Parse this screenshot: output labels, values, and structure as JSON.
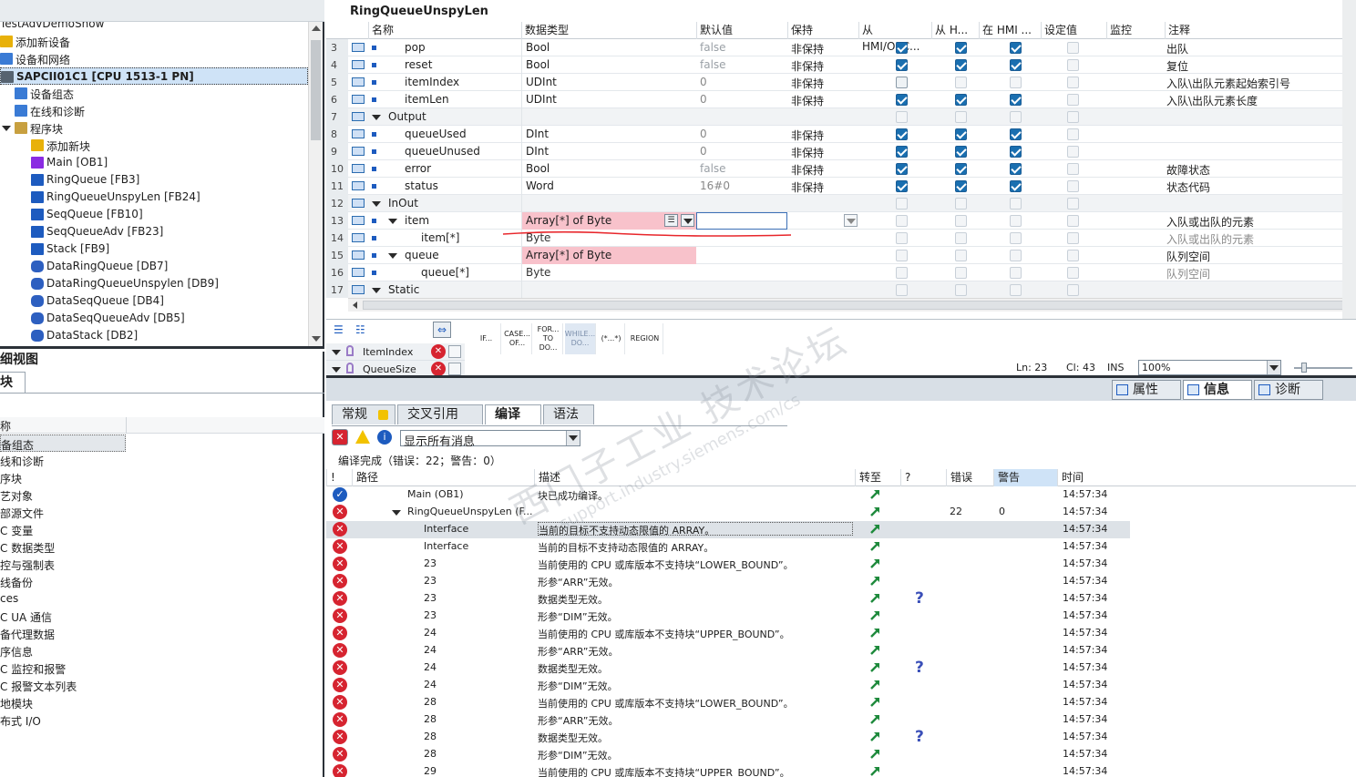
{
  "tree": {
    "items": [
      {
        "label": "TestAdvDemoShow",
        "icon": "project-icon",
        "indent": 0
      },
      {
        "label": "添加新设备",
        "icon": "add-device-icon",
        "indent": 1
      },
      {
        "label": "设备和网络",
        "icon": "network-icon",
        "indent": 1
      },
      {
        "label": "SAPCII01C1 [CPU 1513-1 PN]",
        "icon": "cpu-icon",
        "indent": 1,
        "selected": true
      },
      {
        "label": "设备组态",
        "icon": "device-config-icon",
        "indent": 2
      },
      {
        "label": "在线和诊断",
        "icon": "online-diag-icon",
        "indent": 2
      },
      {
        "label": "程序块",
        "icon": "folder-icon",
        "indent": 2
      },
      {
        "label": "添加新块",
        "icon": "add-block-icon",
        "indent": 3
      },
      {
        "label": "Main [OB1]",
        "icon": "ob-icon",
        "indent": 3
      },
      {
        "label": "RingQueue [FB3]",
        "icon": "fb-icon",
        "indent": 3
      },
      {
        "label": "RingQueueUnspyLen [FB24]",
        "icon": "fb-icon",
        "indent": 3
      },
      {
        "label": "SeqQueue [FB10]",
        "icon": "fb-icon",
        "indent": 3
      },
      {
        "label": "SeqQueueAdv [FB23]",
        "icon": "fb-icon",
        "indent": 3
      },
      {
        "label": "Stack [FB9]",
        "icon": "fb-icon",
        "indent": 3
      },
      {
        "label": "DataRingQueue [DB7]",
        "icon": "db-icon",
        "indent": 3
      },
      {
        "label": "DataRingQueueUnspylen [DB9]",
        "icon": "db-icon",
        "indent": 3
      },
      {
        "label": "DataSeqQueue [DB4]",
        "icon": "db-icon",
        "indent": 3
      },
      {
        "label": "DataSeqQueueAdv [DB5]",
        "icon": "db-icon",
        "indent": 3
      },
      {
        "label": "DataStack [DB2]",
        "icon": "db-icon",
        "indent": 3
      }
    ]
  },
  "detail": {
    "title": "细视图",
    "tab": "块",
    "col_header": "称",
    "items": [
      "备组态",
      "线和诊断",
      "序块",
      "艺对象",
      "部源文件",
      "C 变量",
      "C 数据类型",
      "控与强制表",
      "线备份",
      "ces",
      "C UA 通信",
      "备代理数据",
      "序信息",
      "C 监控和报警",
      "C 报警文本列表",
      "地模块",
      "布式 I/O"
    ]
  },
  "block": {
    "title": "RingQueueUnspyLen",
    "headers": [
      "名称",
      "数据类型",
      "默认值",
      "保持",
      "从 HMI/OPC...",
      "从 H...",
      "在 HMI ...",
      "设定值",
      "监控",
      "注释"
    ],
    "rows": [
      {
        "num": "3",
        "name": "pop",
        "type": "Bool",
        "def": "false",
        "ret": "非保持",
        "c1": "on",
        "c2": "on",
        "c3": "on",
        "note": "出队",
        "lvl": 1
      },
      {
        "num": "4",
        "name": "reset",
        "type": "Bool",
        "def": "false",
        "ret": "非保持",
        "c1": "on",
        "c2": "on",
        "c3": "on",
        "note": "复位",
        "lvl": 1
      },
      {
        "num": "5",
        "name": "itemIndex",
        "type": "UDInt",
        "def": "0",
        "ret": "非保持",
        "c1": "off",
        "c2": "dis",
        "c3": "dis",
        "note": "入队\\出队元素起始索引号",
        "lvl": 1
      },
      {
        "num": "6",
        "name": "itemLen",
        "type": "UDInt",
        "def": "0",
        "ret": "非保持",
        "c1": "on",
        "c2": "on",
        "c3": "on",
        "note": "入队\\出队元素长度",
        "lvl": 1
      },
      {
        "num": "7",
        "name": "Output",
        "type": "",
        "def": "",
        "ret": "",
        "c1": "dis",
        "c2": "dis",
        "c3": "dis",
        "note": "",
        "lvl": 0,
        "group": true
      },
      {
        "num": "8",
        "name": "queueUsed",
        "type": "DInt",
        "def": "0",
        "ret": "非保持",
        "c1": "on",
        "c2": "on",
        "c3": "on",
        "note": "",
        "lvl": 1
      },
      {
        "num": "9",
        "name": "queueUnused",
        "type": "DInt",
        "def": "0",
        "ret": "非保持",
        "c1": "on",
        "c2": "on",
        "c3": "on",
        "note": "",
        "lvl": 1
      },
      {
        "num": "10",
        "name": "error",
        "type": "Bool",
        "def": "false",
        "ret": "非保持",
        "c1": "on",
        "c2": "on",
        "c3": "on",
        "note": "故障状态",
        "lvl": 1
      },
      {
        "num": "11",
        "name": "status",
        "type": "Word",
        "def": "16#0",
        "ret": "非保持",
        "c1": "on",
        "c2": "on",
        "c3": "on",
        "note": "状态代码",
        "lvl": 1
      },
      {
        "num": "12",
        "name": "InOut",
        "type": "",
        "def": "",
        "ret": "",
        "c1": "dis",
        "c2": "dis",
        "c3": "dis",
        "note": "",
        "lvl": 0,
        "group": true
      },
      {
        "num": "13",
        "name": "item",
        "type": "Array[*] of Byte",
        "def": "",
        "ret": "",
        "c1": "dis",
        "c2": "dis",
        "c3": "dis",
        "note": "入队或出队的元素",
        "lvl": 1,
        "expand": true,
        "pink": true,
        "editing": true
      },
      {
        "num": "14",
        "name": "item[*]",
        "type": "Byte",
        "def": "",
        "ret": "",
        "c1": "dis",
        "c2": "dis",
        "c3": "dis",
        "note": "入队或出队的元素",
        "lvl": 2,
        "grey": true
      },
      {
        "num": "15",
        "name": "queue",
        "type": "Array[*] of Byte",
        "def": "",
        "ret": "",
        "c1": "dis",
        "c2": "dis",
        "c3": "dis",
        "note": "队列空间",
        "lvl": 1,
        "expand": true,
        "pink": true
      },
      {
        "num": "16",
        "name": "queue[*]",
        "type": "Byte",
        "def": "",
        "ret": "",
        "c1": "dis",
        "c2": "dis",
        "c3": "dis",
        "note": "队列空间",
        "lvl": 2,
        "grey": true
      },
      {
        "num": "17",
        "name": "Static",
        "type": "",
        "def": "",
        "ret": "",
        "c1": "dis",
        "c2": "dis",
        "c3": "dis",
        "note": "",
        "lvl": 0,
        "group": true
      }
    ]
  },
  "editor": {
    "vars": [
      "ItemIndex",
      "QueueSize"
    ],
    "instructions": [
      "IF...",
      "CASE... OF...",
      "FOR... TO DO...",
      "WHILE... DO...",
      "(*...*)",
      "REGION"
    ],
    "ln": "Ln: 23",
    "cl": "Cl: 43",
    "ins": "INS",
    "zoom": "100%"
  },
  "inspector": {
    "tabs": [
      "属性",
      "信息",
      "诊断"
    ]
  },
  "info": {
    "tabs": [
      "常规",
      "交叉引用",
      "编译",
      "语法"
    ],
    "filter": "显示所有消息",
    "summary": "编译完成（错误：22；警告：0）",
    "headers": [
      "!",
      "路径",
      "描述",
      "转至",
      "?",
      "错误",
      "警告",
      "时间"
    ],
    "rows": [
      {
        "type": "ok",
        "path": "Main (OB1)",
        "desc": "块已成功编译。",
        "q": false,
        "err": "",
        "warn": "",
        "time": "14:57:34",
        "lvl": 0
      },
      {
        "type": "err",
        "path": "RingQueueUnspyLen (F...",
        "desc": "",
        "q": false,
        "err": "22",
        "warn": "0",
        "time": "14:57:34",
        "lvl": 0,
        "expand": true
      },
      {
        "type": "err",
        "path": "Interface",
        "desc": "当前的目标不支持动态限值的 ARRAY。",
        "q": false,
        "err": "",
        "warn": "",
        "time": "14:57:34",
        "lvl": 1,
        "sel": true
      },
      {
        "type": "err",
        "path": "Interface",
        "desc": "当前的目标不支持动态限值的 ARRAY。",
        "q": false,
        "err": "",
        "warn": "",
        "time": "14:57:34",
        "lvl": 1
      },
      {
        "type": "err",
        "path": "23",
        "desc": "当前使用的 CPU 或库版本不支持块“LOWER_BOUND”。",
        "q": false,
        "err": "",
        "warn": "",
        "time": "14:57:34",
        "lvl": 1
      },
      {
        "type": "err",
        "path": "23",
        "desc": "形参“ARR”无效。",
        "q": false,
        "err": "",
        "warn": "",
        "time": "14:57:34",
        "lvl": 1
      },
      {
        "type": "err",
        "path": "23",
        "desc": "数据类型无效。",
        "q": true,
        "err": "",
        "warn": "",
        "time": "14:57:34",
        "lvl": 1
      },
      {
        "type": "err",
        "path": "23",
        "desc": "形参“DIM”无效。",
        "q": false,
        "err": "",
        "warn": "",
        "time": "14:57:34",
        "lvl": 1
      },
      {
        "type": "err",
        "path": "24",
        "desc": "当前使用的 CPU 或库版本不支持块“UPPER_BOUND”。",
        "q": false,
        "err": "",
        "warn": "",
        "time": "14:57:34",
        "lvl": 1
      },
      {
        "type": "err",
        "path": "24",
        "desc": "形参“ARR”无效。",
        "q": false,
        "err": "",
        "warn": "",
        "time": "14:57:34",
        "lvl": 1
      },
      {
        "type": "err",
        "path": "24",
        "desc": "数据类型无效。",
        "q": true,
        "err": "",
        "warn": "",
        "time": "14:57:34",
        "lvl": 1
      },
      {
        "type": "err",
        "path": "24",
        "desc": "形参“DIM”无效。",
        "q": false,
        "err": "",
        "warn": "",
        "time": "14:57:34",
        "lvl": 1
      },
      {
        "type": "err",
        "path": "28",
        "desc": "当前使用的 CPU 或库版本不支持块“LOWER_BOUND”。",
        "q": false,
        "err": "",
        "warn": "",
        "time": "14:57:34",
        "lvl": 1
      },
      {
        "type": "err",
        "path": "28",
        "desc": "形参“ARR”无效。",
        "q": false,
        "err": "",
        "warn": "",
        "time": "14:57:34",
        "lvl": 1
      },
      {
        "type": "err",
        "path": "28",
        "desc": "数据类型无效。",
        "q": true,
        "err": "",
        "warn": "",
        "time": "14:57:34",
        "lvl": 1
      },
      {
        "type": "err",
        "path": "28",
        "desc": "形参“DIM”无效。",
        "q": false,
        "err": "",
        "warn": "",
        "time": "14:57:34",
        "lvl": 1
      },
      {
        "type": "err",
        "path": "29",
        "desc": "当前使用的 CPU 或库版本不支持块“UPPER_BOUND”。",
        "q": false,
        "err": "",
        "warn": "",
        "time": "14:57:34",
        "lvl": 1
      }
    ]
  },
  "watermark": {
    "line1": "西门子工业 技术论坛",
    "line2": "support.industry.siemens.com/cs"
  }
}
